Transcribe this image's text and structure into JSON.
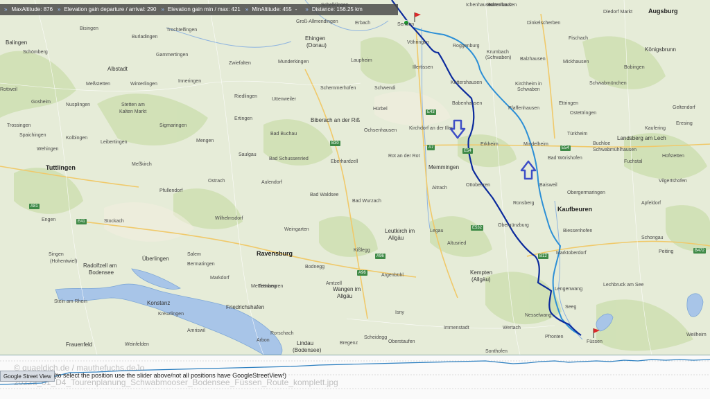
{
  "info_bar": {
    "items": [
      {
        "key": "max_alt",
        "text": "MaxAltitude: 876"
      },
      {
        "key": "gain_dep_arr",
        "text": "Elevation gain departure / arrival: 290"
      },
      {
        "key": "gain_min_max",
        "text": "Elevation gain min / max: 421"
      },
      {
        "key": "min_alt",
        "text": "MinAltitude: 455"
      },
      {
        "key": "distance",
        "text": "Distance: 156.25 km"
      }
    ],
    "separator_glyph": "»",
    "dash_glyph": "-"
  },
  "map": {
    "route_colors": {
      "outbound": "#0b2a9c",
      "return": "#2c8fd6",
      "direction_arrow": "#3d4ec6"
    },
    "towns": [
      {
        "id": "augsburg",
        "name": "Augsburg",
        "cls": "big"
      },
      {
        "id": "balingen",
        "name": "Balingen",
        "cls": "mid"
      },
      {
        "id": "albstadt",
        "name": "Albstadt",
        "cls": "mid"
      },
      {
        "id": "ehingen",
        "name": "Ehingen",
        "cls": "mid"
      },
      {
        "id": "ehingen2",
        "name": "(Donau)",
        "cls": "mid"
      },
      {
        "id": "biberach",
        "name": "Biberach an der Riß",
        "cls": "mid"
      },
      {
        "id": "memmingen",
        "name": "Memmingen",
        "cls": "mid"
      },
      {
        "id": "tuttlingen",
        "name": "Tuttlingen",
        "cls": "big"
      },
      {
        "id": "ravensburg",
        "name": "Ravensburg",
        "cls": "big"
      },
      {
        "id": "friedrichshafen",
        "name": "Friedrichshafen",
        "cls": "mid"
      },
      {
        "id": "konstanz",
        "name": "Konstanz",
        "cls": "mid"
      },
      {
        "id": "ueberlingen",
        "name": "Überlingen",
        "cls": "mid"
      },
      {
        "id": "radolfzell",
        "name": "Radolfzell am",
        "cls": "mid"
      },
      {
        "id": "radolfzell2",
        "name": "Bodensee",
        "cls": "mid"
      },
      {
        "id": "kempten",
        "name": "Kempten",
        "cls": "mid"
      },
      {
        "id": "kempten2",
        "name": "(Allgäu)",
        "cls": "mid"
      },
      {
        "id": "kaufbeuren",
        "name": "Kaufbeuren",
        "cls": "big"
      },
      {
        "id": "landsberg",
        "name": "Landsberg am Lech",
        "cls": "mid"
      },
      {
        "id": "koenigsbrunn",
        "name": "Königsbrunn",
        "cls": "mid"
      },
      {
        "id": "wangen",
        "name": "Wangen im",
        "cls": "mid"
      },
      {
        "id": "wangen2",
        "name": "Allgäu",
        "cls": "mid"
      },
      {
        "id": "leutkirch",
        "name": "Leutkirch im",
        "cls": "mid"
      },
      {
        "id": "leutkirch2",
        "name": "Allgäu",
        "cls": "mid"
      },
      {
        "id": "lindau",
        "name": "Lindau",
        "cls": "mid"
      },
      {
        "id": "lindau2",
        "name": "(Bodensee)",
        "cls": "mid"
      },
      {
        "id": "frauenfeld",
        "name": "Frauenfeld",
        "cls": "mid"
      },
      {
        "id": "mindelheim",
        "name": "Mindelheim",
        "cls": ""
      },
      {
        "id": "vöhringen",
        "name": "Vöhringen",
        "cls": ""
      },
      {
        "id": "illertissen",
        "name": "Illertissen",
        "cls": ""
      },
      {
        "id": "krumbach",
        "name": "Krumbach",
        "cls": ""
      },
      {
        "id": "krumbach2",
        "name": "(Schwaben)",
        "cls": ""
      },
      {
        "id": "babenhausen",
        "name": "Babenhausen",
        "cls": ""
      },
      {
        "id": "kettershausen",
        "name": "Kettershausen",
        "cls": ""
      },
      {
        "id": "pfaffenhausen",
        "name": "Pfaffenhausen",
        "cls": ""
      },
      {
        "id": "kirchheim",
        "name": "Kirchheim in",
        "cls": ""
      },
      {
        "id": "kirchheim2",
        "name": "Schwaben",
        "cls": ""
      },
      {
        "id": "erkheim",
        "name": "Erkheim",
        "cls": ""
      },
      {
        "id": "ottobeuren",
        "name": "Ottobeuren",
        "cls": ""
      },
      {
        "id": "ronsberg",
        "name": "Ronsberg",
        "cls": ""
      },
      {
        "id": "obergünzburg",
        "name": "Obergünzburg",
        "cls": ""
      },
      {
        "id": "marktoberdorf",
        "name": "Marktoberdorf",
        "cls": ""
      },
      {
        "id": "füssen",
        "name": "Füssen",
        "cls": ""
      },
      {
        "id": "pfronten",
        "name": "Pfronten",
        "cls": ""
      },
      {
        "id": "bad-wörishofen",
        "name": "Bad Wörishofen",
        "cls": ""
      },
      {
        "id": "buchloe",
        "name": "Buchloe",
        "cls": ""
      },
      {
        "id": "türkheim",
        "name": "Türkheim",
        "cls": ""
      },
      {
        "id": "schwabmünchen",
        "name": "Schwabmünchen",
        "cls": ""
      },
      {
        "id": "laupheim",
        "name": "Laupheim",
        "cls": ""
      },
      {
        "id": "ochsenhausen",
        "name": "Ochsenhausen",
        "cls": ""
      },
      {
        "id": "bad-waldsee",
        "name": "Bad Waldsee",
        "cls": ""
      },
      {
        "id": "bad-wurzach",
        "name": "Bad Wurzach",
        "cls": ""
      },
      {
        "id": "isny",
        "name": "Isny",
        "cls": ""
      },
      {
        "id": "saulgau",
        "name": "Saulgau",
        "cls": ""
      },
      {
        "id": "bad-buchau",
        "name": "Bad Buchau",
        "cls": ""
      },
      {
        "id": "riedlingen",
        "name": "Riedlingen",
        "cls": ""
      },
      {
        "id": "sigmaringen",
        "name": "Sigmaringen",
        "cls": ""
      },
      {
        "id": "meßkirch",
        "name": "Meßkirch",
        "cls": ""
      },
      {
        "id": "stockach",
        "name": "Stockach",
        "cls": ""
      },
      {
        "id": "markdorf",
        "name": "Markdorf",
        "cls": ""
      },
      {
        "id": "tettnang",
        "name": "Tettnang",
        "cls": ""
      },
      {
        "id": "bad-schussenried",
        "name": "Bad Schussenried",
        "cls": ""
      },
      {
        "id": "aulendorf",
        "name": "Aulendorf",
        "cls": ""
      },
      {
        "id": "weingarten",
        "name": "Weingarten",
        "cls": ""
      },
      {
        "id": "kißlegg",
        "name": "Kißlegg",
        "cls": ""
      },
      {
        "id": "aitrach",
        "name": "Aitrach",
        "cls": ""
      },
      {
        "id": "legau",
        "name": "Legau",
        "cls": ""
      },
      {
        "id": "altusried",
        "name": "Altusried",
        "cls": ""
      },
      {
        "id": "immenstadt",
        "name": "Immenstadt",
        "cls": ""
      },
      {
        "id": "sonthofen",
        "name": "Sonthofen",
        "cls": ""
      },
      {
        "id": "oberstaufen",
        "name": "Oberstaufen",
        "cls": ""
      },
      {
        "id": "lechbruck",
        "name": "Lechbruck am See",
        "cls": ""
      },
      {
        "id": "schongau",
        "name": "Schongau",
        "cls": ""
      },
      {
        "id": "peiting",
        "name": "Peiting",
        "cls": ""
      },
      {
        "id": "weilheim",
        "name": "Weilheim",
        "cls": ""
      },
      {
        "id": "gosheim",
        "name": "Gosheim",
        "cls": ""
      },
      {
        "id": "rottweil",
        "name": "Rottweil",
        "cls": ""
      },
      {
        "id": "trossingen",
        "name": "Trossingen",
        "cls": ""
      },
      {
        "id": "spaichingen",
        "name": "Spaichingen",
        "cls": ""
      },
      {
        "id": "engen",
        "name": "Engen",
        "cls": ""
      },
      {
        "id": "singen",
        "name": "Singen",
        "cls": ""
      },
      {
        "id": "singen2",
        "name": "(Hohentwiel)",
        "cls": ""
      },
      {
        "id": "stein",
        "name": "Stein am Rhein",
        "cls": ""
      },
      {
        "id": "kreuzlingen",
        "name": "Kreuzlingen",
        "cls": ""
      },
      {
        "id": "arbon",
        "name": "Arbon",
        "cls": ""
      },
      {
        "id": "rorschach",
        "name": "Rorschach",
        "cls": ""
      },
      {
        "id": "bregenz",
        "name": "Bregenz",
        "cls": ""
      },
      {
        "id": "weinfelden",
        "name": "Weinfelden",
        "cls": ""
      },
      {
        "id": "amriswil",
        "name": "Amriswil",
        "cls": ""
      },
      {
        "id": "mengen",
        "name": "Mengen",
        "cls": ""
      },
      {
        "id": "pfullendorf",
        "name": "Pfullendorf",
        "cls": ""
      },
      {
        "id": "ostrach",
        "name": "Ostrach",
        "cls": ""
      },
      {
        "id": "wilhelmsdorf",
        "name": "Wilhelmsdorf",
        "cls": ""
      },
      {
        "id": "salem",
        "name": "Salem",
        "cls": ""
      },
      {
        "id": "bermatingen",
        "name": "Bermatingen",
        "cls": ""
      },
      {
        "id": "meckenbeuren",
        "name": "Meckenbeuren",
        "cls": ""
      },
      {
        "id": "bodnegg",
        "name": "Bodnegg",
        "cls": ""
      },
      {
        "id": "amtzell",
        "name": "Amtzell",
        "cls": ""
      },
      {
        "id": "argenbühl",
        "name": "Argenbühl",
        "cls": ""
      },
      {
        "id": "scheidegg",
        "name": "Scheidegg",
        "cls": ""
      },
      {
        "id": "wertach",
        "name": "Wertach",
        "cls": ""
      },
      {
        "id": "nesselwang",
        "name": "Nesselwang",
        "cls": ""
      },
      {
        "id": "seeg",
        "name": "Seeg",
        "cls": ""
      },
      {
        "id": "lengenwang",
        "name": "Lengenwang",
        "cls": ""
      },
      {
        "id": "biessenhofen",
        "name": "Biessenhofen",
        "cls": ""
      },
      {
        "id": "obergermaringen",
        "name": "Obergermaringen",
        "cls": ""
      },
      {
        "id": "baisweil",
        "name": "Baisweil",
        "cls": ""
      },
      {
        "id": "apfeldorf",
        "name": "Apfeldorf",
        "cls": ""
      },
      {
        "id": "fuchstal",
        "name": "Fuchstal",
        "cls": ""
      },
      {
        "id": "hofstetten",
        "name": "Hofstetten",
        "cls": ""
      },
      {
        "id": "vilgertshofen",
        "name": "Vilgertshofen",
        "cls": ""
      },
      {
        "id": "kaufering",
        "name": "Kaufering",
        "cls": ""
      },
      {
        "id": "geltendorf",
        "name": "Geltendorf",
        "cls": ""
      },
      {
        "id": "eresing",
        "name": "Eresing",
        "cls": ""
      },
      {
        "id": "schwabmühlhausen",
        "name": "Schwabmühlhausen",
        "cls": ""
      },
      {
        "id": "ostettringen",
        "name": "Ostettringen",
        "cls": ""
      },
      {
        "id": "ettringen",
        "name": "Ettringen",
        "cls": ""
      },
      {
        "id": "mickhausen",
        "name": "Mickhausen",
        "cls": ""
      },
      {
        "id": "fischach",
        "name": "Fischach",
        "cls": ""
      },
      {
        "id": "dinkelscherben",
        "name": "Dinkelscherben",
        "cls": ""
      },
      {
        "id": "burtenbach",
        "name": "Burtenbach",
        "cls": ""
      },
      {
        "id": "balzhausen",
        "name": "Balzhausen",
        "cls": ""
      },
      {
        "id": "ichenhausen",
        "name": "Ichenhausen",
        "cls": ""
      },
      {
        "id": "diedorf",
        "name": "Diedorf Markt",
        "cls": ""
      },
      {
        "id": "bobingen",
        "name": "Bobingen",
        "cls": ""
      },
      {
        "id": "roggenburg",
        "name": "Roggenburg",
        "cls": ""
      },
      {
        "id": "senden",
        "name": "Senden",
        "cls": ""
      },
      {
        "id": "erbach",
        "name": "Erbach",
        "cls": ""
      },
      {
        "id": "schwendi",
        "name": "Schwendi",
        "cls": ""
      },
      {
        "id": "hürbel",
        "name": "Hürbel",
        "cls": ""
      },
      {
        "id": "kirchdorf",
        "name": "Kirchdorf an der Iller",
        "cls": ""
      },
      {
        "id": "rot",
        "name": "Rot an der Rot",
        "cls": ""
      },
      {
        "id": "eberhardzell",
        "name": "Eberhardzell",
        "cls": ""
      },
      {
        "id": "schemmerhofen",
        "name": "Schemmerhofen",
        "cls": ""
      },
      {
        "id": "uttenweiler",
        "name": "Uttenweiler",
        "cls": ""
      },
      {
        "id": "ertingen",
        "name": "Ertingen",
        "cls": ""
      },
      {
        "id": "zwiefalten",
        "name": "Zwiefalten",
        "cls": ""
      },
      {
        "id": "munderkingen",
        "name": "Munderkingen",
        "cls": ""
      },
      {
        "id": "gammertingen",
        "name": "Gammertingen",
        "cls": ""
      },
      {
        "id": "winterlingen",
        "name": "Winterlingen",
        "cls": ""
      },
      {
        "id": "inneringen",
        "name": "Inneringen",
        "cls": ""
      },
      {
        "id": "stetten",
        "name": "Stetten am",
        "cls": ""
      },
      {
        "id": "stetten2",
        "name": "Kalten Markt",
        "cls": ""
      },
      {
        "id": "leibertingen",
        "name": "Leibertingen",
        "cls": ""
      },
      {
        "id": "nusplingen",
        "name": "Nusplingen",
        "cls": ""
      },
      {
        "id": "kolbingen",
        "name": "Kolbingen",
        "cls": ""
      },
      {
        "id": "wehingen",
        "name": "Wehingen",
        "cls": ""
      },
      {
        "id": "schömberg",
        "name": "Schömberg",
        "cls": ""
      },
      {
        "id": "meßstetten",
        "name": "Meßstetten",
        "cls": ""
      },
      {
        "id": "bisingen",
        "name": "Bisingen",
        "cls": ""
      },
      {
        "id": "burladingen",
        "name": "Burladingen",
        "cls": ""
      },
      {
        "id": "trochtelfingen",
        "name": "Trochtelfingen",
        "cls": ""
      },
      {
        "id": "großallmendingen",
        "name": "Groß-Allmendingen",
        "cls": ""
      },
      {
        "id": "schelklingen",
        "name": "Schelklingen",
        "cls": ""
      },
      {
        "id": "ichenhausen2",
        "name": "Ichenhausen",
        "cls": ""
      }
    ],
    "shields": [
      {
        "id": "a7-1",
        "text": "A7"
      },
      {
        "id": "a96-1",
        "text": "A96"
      },
      {
        "id": "e54-1",
        "text": "E54"
      },
      {
        "id": "e43",
        "text": "E43"
      },
      {
        "id": "a81",
        "text": "A81"
      },
      {
        "id": "e54-2",
        "text": "E54"
      },
      {
        "id": "b30",
        "text": "B30"
      },
      {
        "id": "b12",
        "text": "B12"
      },
      {
        "id": "e532",
        "text": "E532"
      },
      {
        "id": "b472",
        "text": "B472"
      },
      {
        "id": "a96-2",
        "text": "A96"
      },
      {
        "id": "e41",
        "text": "E41"
      }
    ]
  },
  "elevation_panel": {
    "streetview_button": "Google Street View",
    "hint": "(to select the position use the slider above/not all positions have GoogleStreetView!)",
    "watermark_copy": "© quaeldich.de / mauthefuchs.deJo",
    "watermark_file": "2022a_01_D4_Tourenplanung_Schwabmooser_Bodensee_Füssen_Route_komplett.jpg"
  }
}
